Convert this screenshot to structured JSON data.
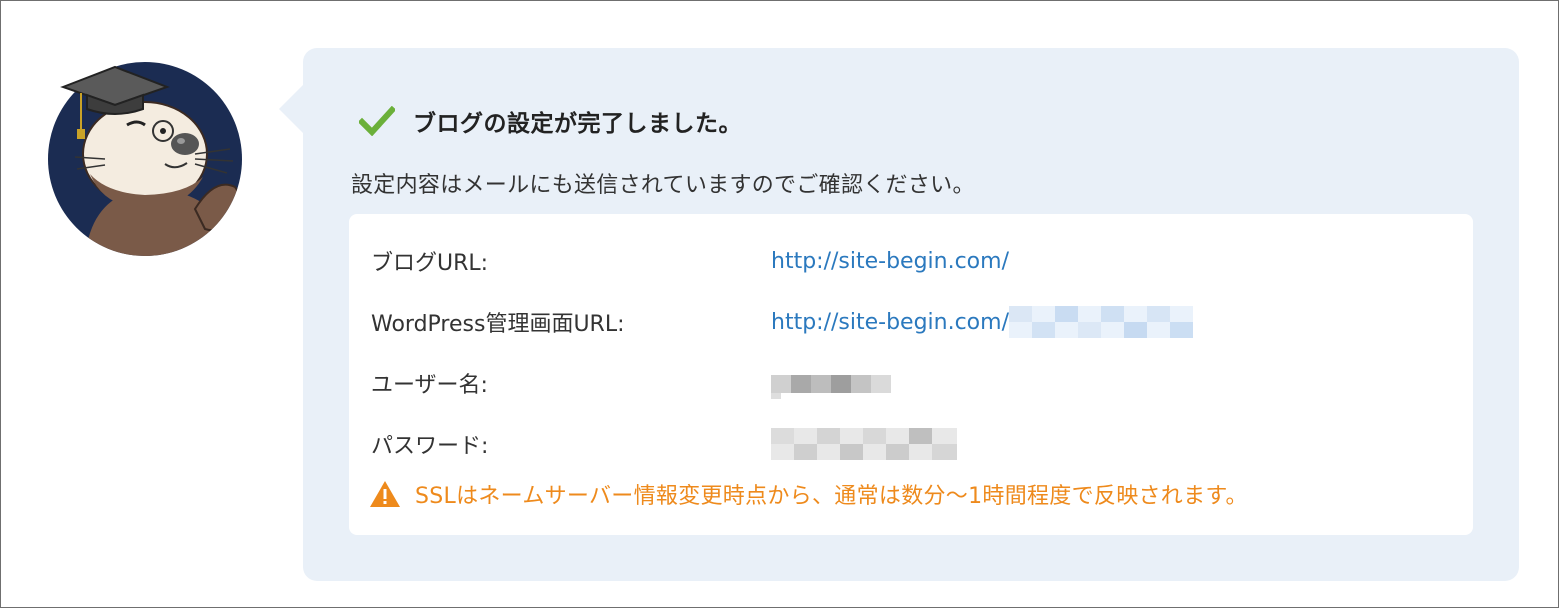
{
  "message": {
    "title": "ブログの設定が完了しました。",
    "subtitle": "設定内容はメールにも送信されていますのでご確認ください。"
  },
  "details": {
    "blog_url": {
      "label": "ブログURL:",
      "value": "http://site-begin.com/"
    },
    "admin_url": {
      "label": "WordPress管理画面URL:",
      "value": "http://site-begin.com/"
    },
    "username": {
      "label": "ユーザー名:"
    },
    "password": {
      "label": "パスワード:"
    }
  },
  "notice": {
    "text": "SSLはネームサーバー情報変更時点から、通常は数分〜1時間程度で反映されます。"
  },
  "icons": {
    "avatar": "sea-otter-graduate-avatar",
    "success": "check-icon",
    "warning": "warning-triangle-icon"
  },
  "colors": {
    "bubble_bg": "#e9f0f8",
    "success": "#6bb03a",
    "link": "#2b79be",
    "warning": "#ee8a1c"
  }
}
